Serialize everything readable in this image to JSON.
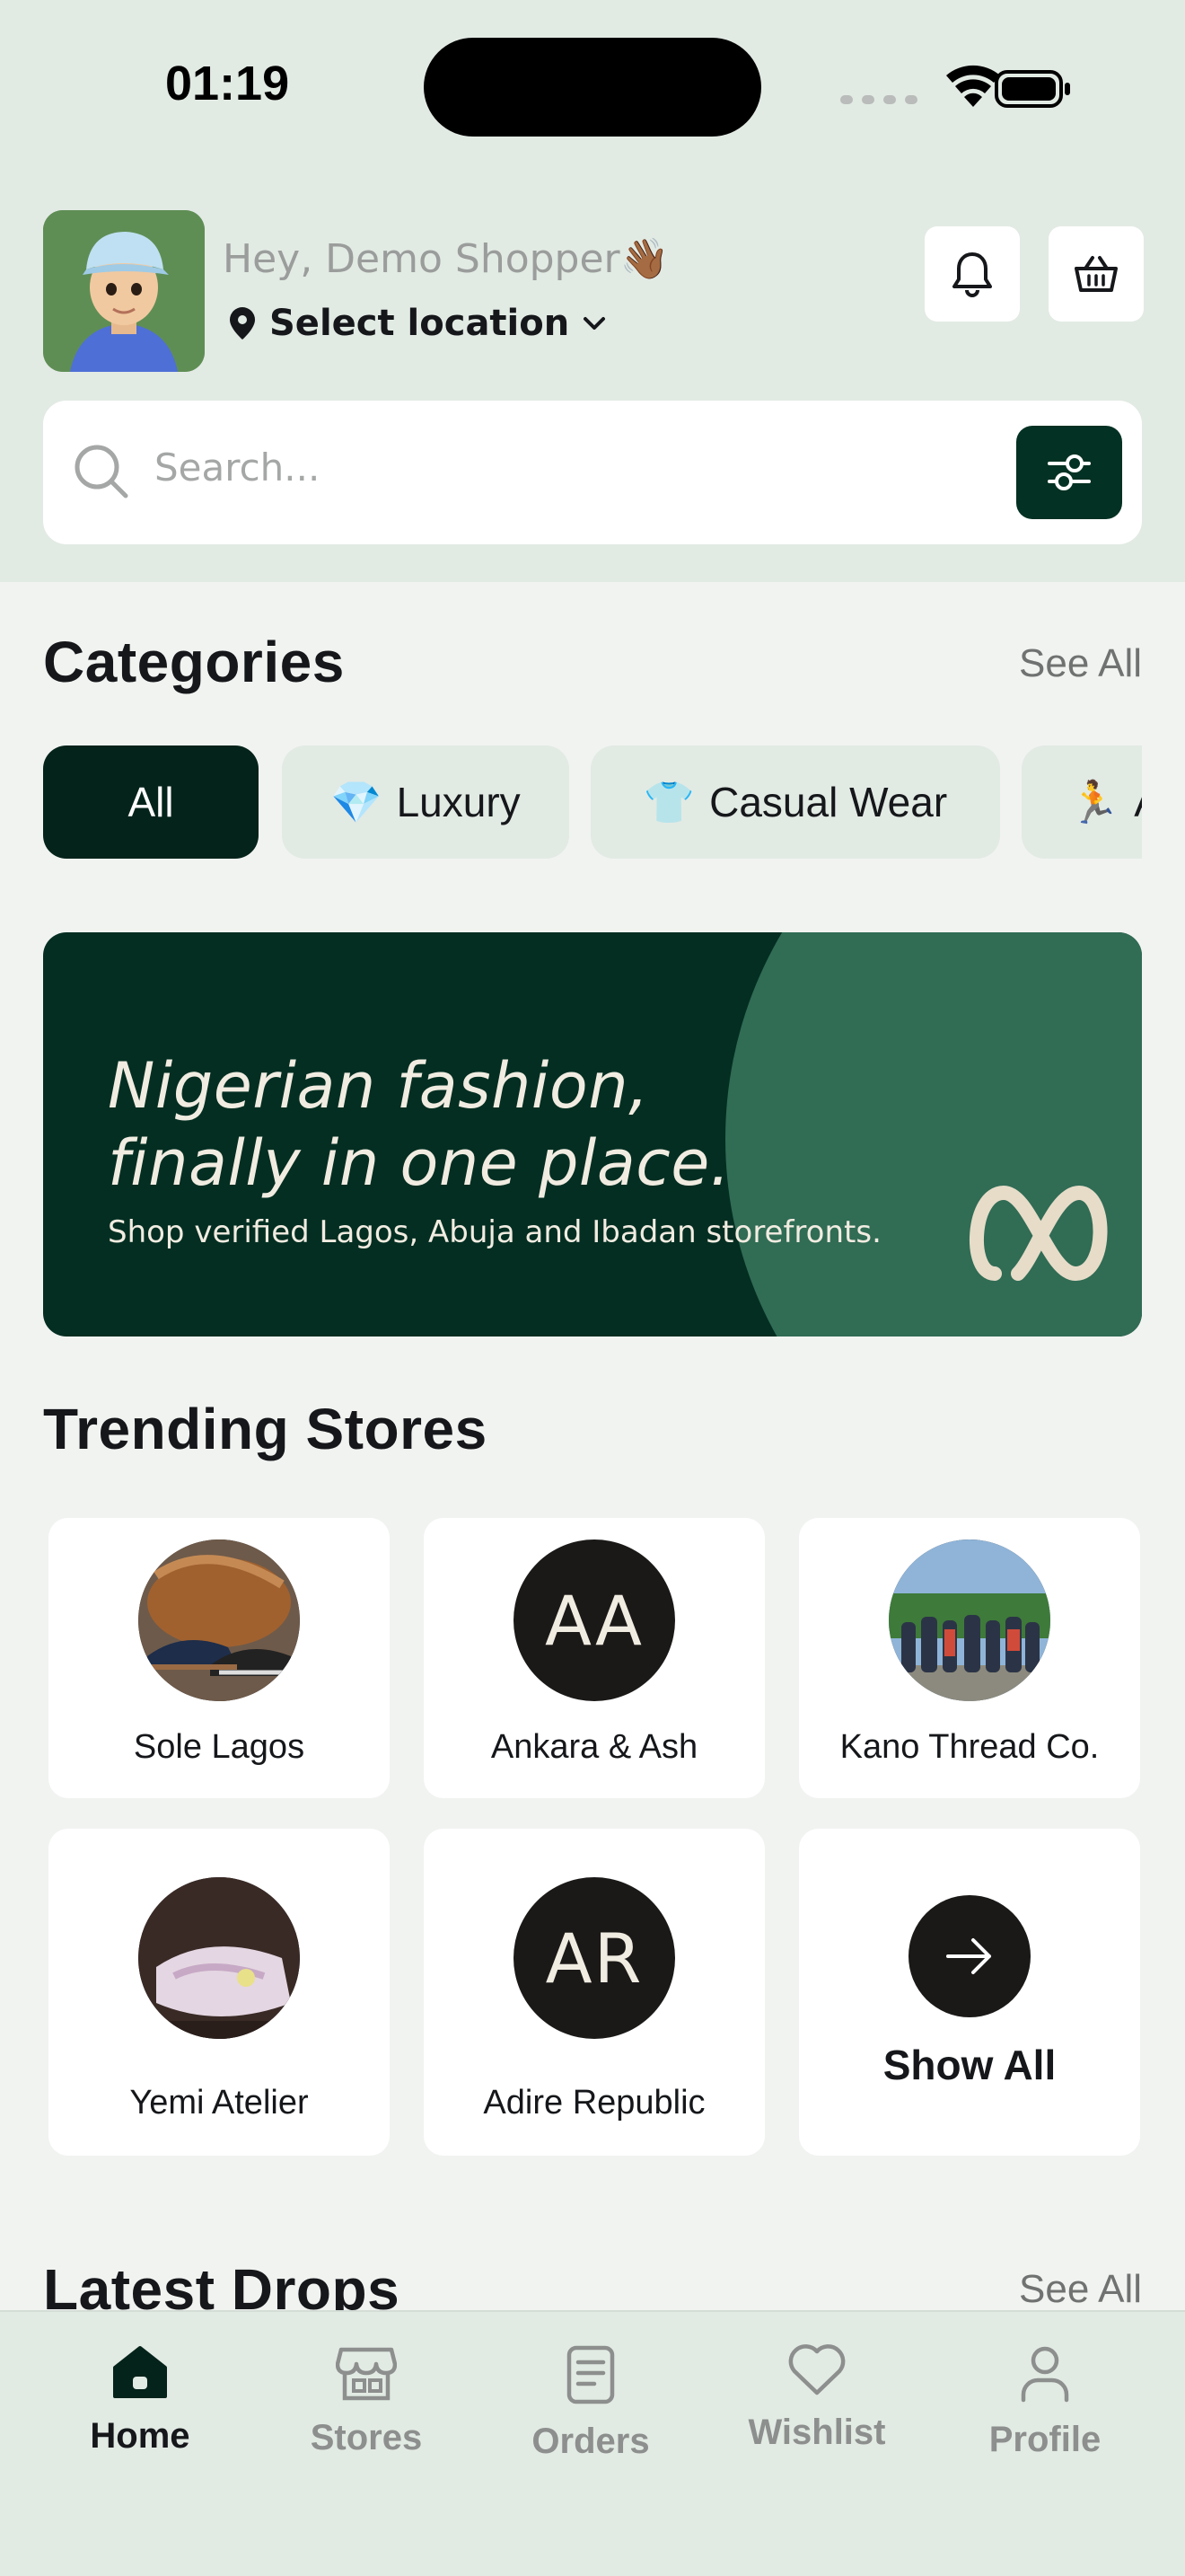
{
  "status_bar": {
    "time": "01:19"
  },
  "header": {
    "greeting": "Hey, Demo Shopper👋🏾",
    "location": "Select location"
  },
  "search": {
    "placeholder": "Search..."
  },
  "categories": {
    "title": "Categories",
    "see_all": "See All",
    "chips": [
      {
        "label": "All",
        "icon": "",
        "active": true
      },
      {
        "label": "Luxury",
        "icon": "💎",
        "active": false
      },
      {
        "label": "Casual Wear",
        "icon": "👕",
        "active": false
      },
      {
        "label": "A",
        "icon": "🏃",
        "active": false
      }
    ]
  },
  "banner": {
    "title_line1": "Nigerian fashion,",
    "title_line2": "finally in one place.",
    "subtitle": "Shop verified Lagos, Abuja and Ibadan storefronts."
  },
  "trending": {
    "title": "Trending Stores",
    "stores": [
      {
        "name": "Sole Lagos",
        "initials": "",
        "image": "shoes-photo"
      },
      {
        "name": "Ankara & Ash",
        "initials": "AA",
        "image": ""
      },
      {
        "name": "Kano Thread Co.",
        "initials": "",
        "image": "group-photo"
      },
      {
        "name": "Yemi Atelier",
        "initials": "",
        "image": "dress-photo"
      },
      {
        "name": "Adire Republic",
        "initials": "AR",
        "image": ""
      }
    ],
    "show_all": "Show All"
  },
  "latest": {
    "title": "Latest Drops",
    "see_all": "See All"
  },
  "tabs": [
    {
      "label": "Home",
      "icon": "home-icon",
      "active": true
    },
    {
      "label": "Stores",
      "icon": "store-icon",
      "active": false
    },
    {
      "label": "Orders",
      "icon": "orders-icon",
      "active": false
    },
    {
      "label": "Wishlist",
      "icon": "heart-icon",
      "active": false
    },
    {
      "label": "Profile",
      "icon": "person-icon",
      "active": false
    }
  ],
  "colors": {
    "header_bg": "#e2eae4",
    "primary_dark": "#033123",
    "banner_accent": "#316c55",
    "cream": "#f1ece1"
  }
}
